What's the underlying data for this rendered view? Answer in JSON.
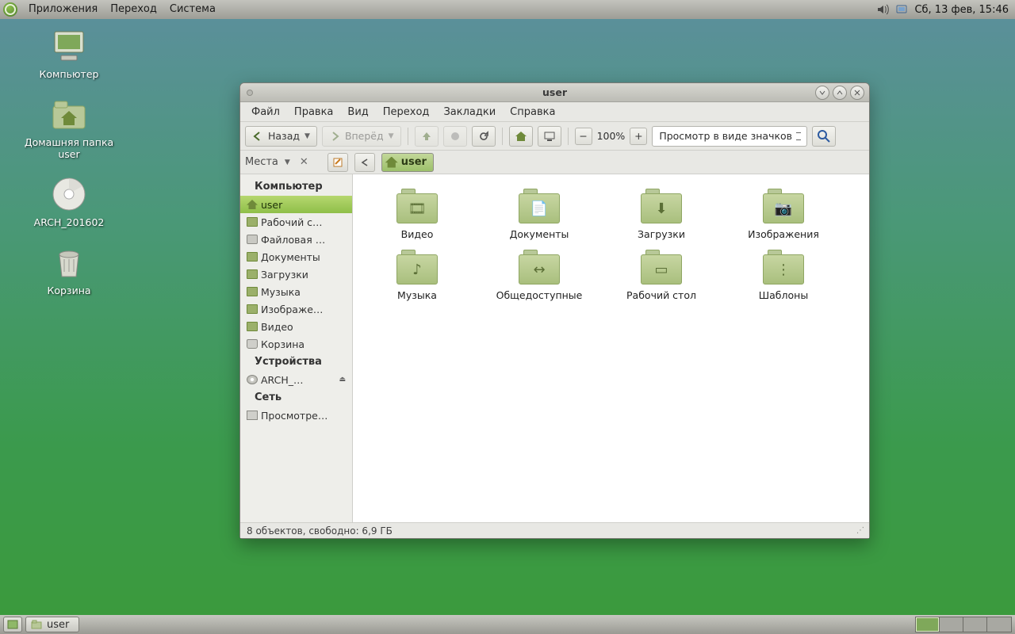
{
  "top_panel": {
    "menu": [
      "Приложения",
      "Переход",
      "Система"
    ],
    "clock": "Сб, 13 фев, 15:46"
  },
  "desktop": {
    "icons": [
      {
        "name": "computer-icon",
        "label": "Компьютер"
      },
      {
        "name": "home-folder-icon",
        "label": "Домашняя папка\nuser"
      },
      {
        "name": "optical-disc-icon",
        "label": "ARCH_201602"
      },
      {
        "name": "trash-icon",
        "label": "Корзина"
      }
    ]
  },
  "window": {
    "title": "user",
    "menubar": [
      "Файл",
      "Правка",
      "Вид",
      "Переход",
      "Закладки",
      "Справка"
    ],
    "toolbar": {
      "back": "Назад",
      "forward": "Вперёд",
      "zoom": "100%",
      "view_mode": "Просмотр в виде значков"
    },
    "places_label": "Места",
    "breadcrumb": "user",
    "sidebar": {
      "sections": [
        {
          "title": "Компьютер",
          "items": [
            {
              "label": "user",
              "icon": "home",
              "selected": true
            },
            {
              "label": "Рабочий с…",
              "icon": "folder"
            },
            {
              "label": "Файловая …",
              "icon": "drive"
            },
            {
              "label": "Документы",
              "icon": "folder"
            },
            {
              "label": "Загрузки",
              "icon": "folder"
            },
            {
              "label": "Музыка",
              "icon": "folder"
            },
            {
              "label": "Изображе…",
              "icon": "folder"
            },
            {
              "label": "Видео",
              "icon": "folder"
            },
            {
              "label": "Корзина",
              "icon": "trash"
            }
          ]
        },
        {
          "title": "Устройства",
          "items": [
            {
              "label": "ARCH_…",
              "icon": "disc",
              "eject": true
            }
          ]
        },
        {
          "title": "Сеть",
          "items": [
            {
              "label": "Просмотре…",
              "icon": "net"
            }
          ]
        }
      ]
    },
    "folders": [
      {
        "label": "Видео",
        "emblem": "🎞"
      },
      {
        "label": "Документы",
        "emblem": "📄"
      },
      {
        "label": "Загрузки",
        "emblem": "⬇"
      },
      {
        "label": "Изображения",
        "emblem": "📷"
      },
      {
        "label": "Музыка",
        "emblem": "♪"
      },
      {
        "label": "Общедоступные",
        "emblem": "↔"
      },
      {
        "label": "Рабочий стол",
        "emblem": "▭"
      },
      {
        "label": "Шаблоны",
        "emblem": "⋮"
      }
    ],
    "statusbar": "8 объектов, свободно: 6,9 ГБ"
  },
  "bottom_panel": {
    "task": "user"
  }
}
